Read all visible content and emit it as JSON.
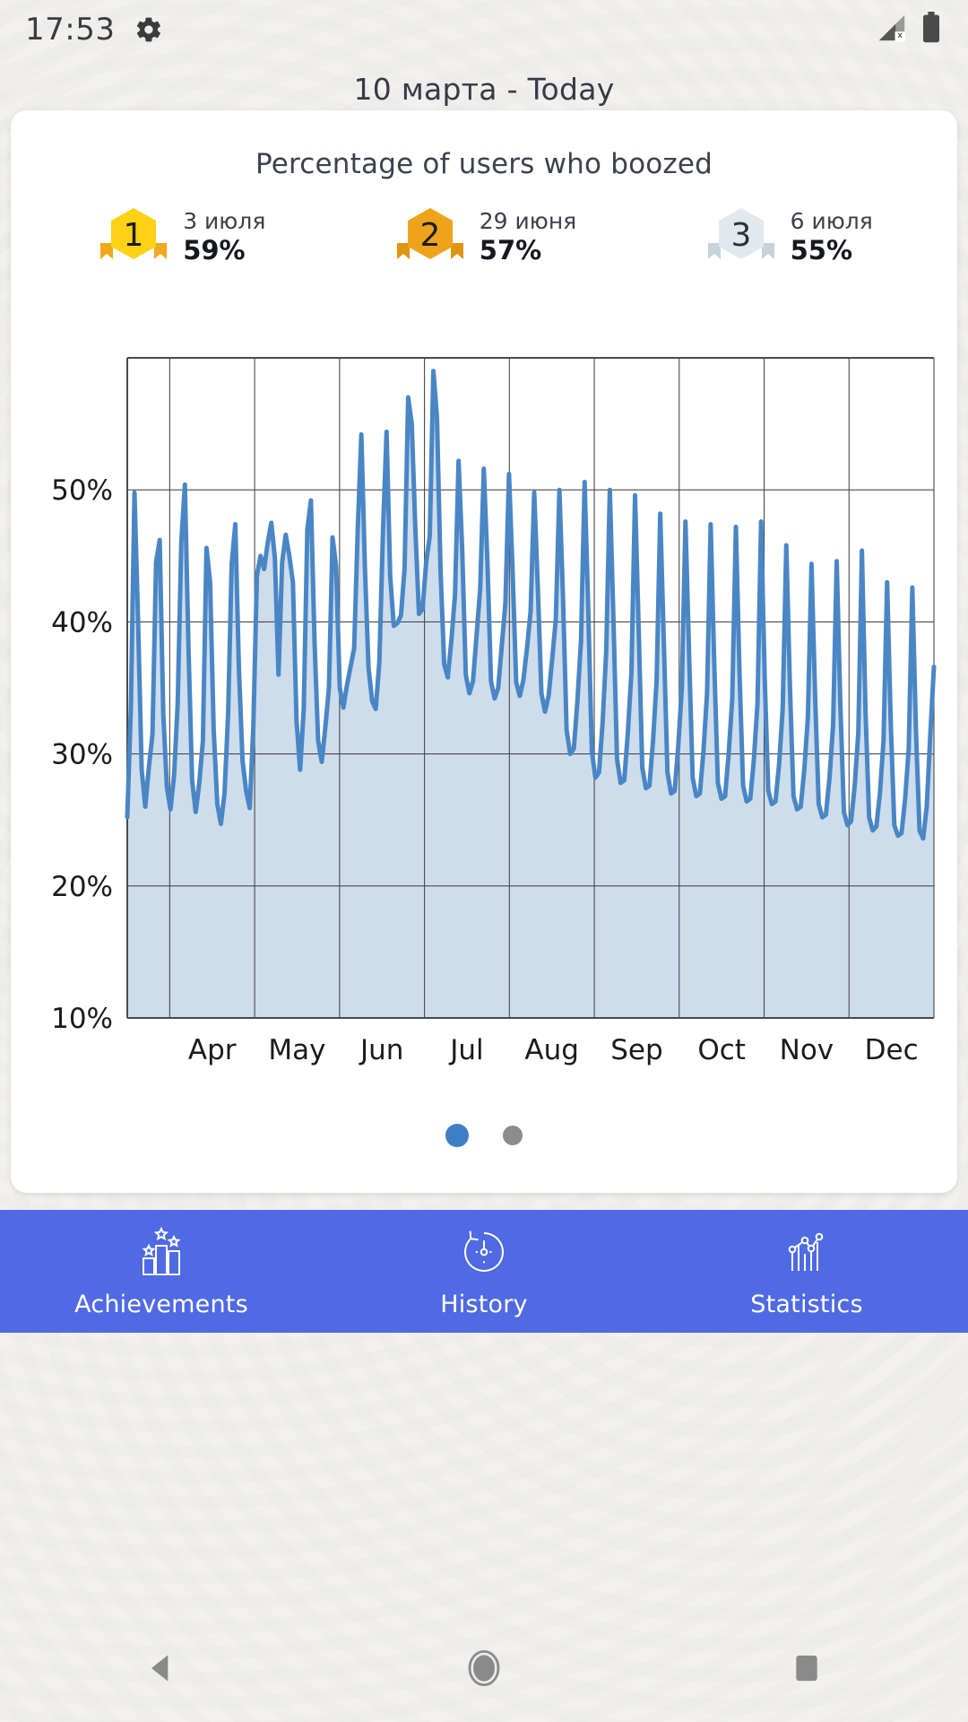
{
  "status_bar": {
    "time": "17:53",
    "gear_icon": "gear-icon",
    "signal_icon": "signal-no-sim-icon",
    "battery_icon": "battery-full-icon"
  },
  "header": {
    "title": "10 марта - Today"
  },
  "card": {
    "title": "Percentage of users who boozed",
    "podium": [
      {
        "rank": "1",
        "date": "3 июля",
        "percent": "59%",
        "color": "#fcd116",
        "ribbon": "#f0a91c",
        "num_color": "#1d1d1b"
      },
      {
        "rank": "2",
        "date": "29 июня",
        "percent": "57%",
        "color": "#eda41c",
        "ribbon": "#e0940f",
        "num_color": "#1d1d1b"
      },
      {
        "rank": "3",
        "date": "6 июля",
        "percent": "55%",
        "color": "#e2e8ed",
        "ribbon": "#c7d2da",
        "num_color": "#2b3138"
      }
    ]
  },
  "pager": {
    "dots": [
      {
        "label": "page-1",
        "active": true
      },
      {
        "label": "page-2",
        "active": false
      }
    ],
    "active_color": "#3c7fc4",
    "inactive_color": "#8c8c8c"
  },
  "bottom_nav": {
    "background": "#506ae4",
    "items": [
      {
        "label": "Achievements",
        "icon": "achievements-bars-stars-icon"
      },
      {
        "label": "History",
        "icon": "history-clock-rewind-icon"
      },
      {
        "label": "Statistics",
        "icon": "statistics-line-bar-icon"
      }
    ]
  },
  "android_nav": {
    "back": "back-triangle-icon",
    "home": "home-circle-icon",
    "recents": "recents-square-icon"
  },
  "chart_data": {
    "type": "area",
    "title": "Percentage of users who boozed",
    "xlabel": "",
    "ylabel": "",
    "grid": true,
    "legend": "none",
    "line_color": "#4a86c5",
    "fill_color": "#cdddec",
    "ylim": [
      10,
      60
    ],
    "yticks": [
      10,
      20,
      30,
      40,
      50
    ],
    "ytick_labels": [
      "10%",
      "20%",
      "30%",
      "40%",
      "50%"
    ],
    "xticks": [
      "Apr",
      "May",
      "Jun",
      "Jul",
      "Aug",
      "Sep",
      "Oct",
      "Nov",
      "Dec"
    ],
    "xlim_note": "mid-March through early December, daily samples with strong weekly cycle",
    "series": [
      {
        "name": "Percentage of users who boozed",
        "values": [
          25.2,
          33.5,
          49.8,
          40.0,
          28.8,
          26.0,
          29.0,
          31.5,
          44.5,
          46.2,
          33.0,
          27.5,
          25.8,
          28.4,
          33.8,
          46.0,
          50.4,
          38.0,
          28.0,
          25.6,
          27.8,
          31.0,
          45.6,
          43.0,
          31.8,
          26.2,
          24.7,
          27.0,
          33.0,
          44.4,
          47.4,
          36.5,
          29.5,
          27.2,
          25.9,
          32.0,
          43.5,
          45.0,
          44.0,
          46.0,
          47.5,
          44.8,
          36.0,
          44.5,
          46.6,
          45.0,
          43.0,
          32.5,
          28.8,
          33.4,
          47.0,
          49.2,
          38.5,
          31.0,
          29.4,
          32.0,
          35.0,
          46.4,
          44.2,
          35.0,
          33.5,
          35.2,
          36.6,
          38.0,
          47.0,
          54.2,
          44.0,
          36.5,
          34.0,
          33.4,
          37.0,
          46.8,
          54.4,
          43.5,
          39.7,
          39.9,
          40.5,
          44.0,
          57.0,
          55.0,
          47.0,
          40.6,
          41.0,
          44.5,
          46.5,
          59.0,
          55.5,
          43.8,
          36.8,
          35.8,
          38.6,
          42.0,
          52.2,
          45.5,
          36.0,
          34.6,
          35.5,
          39.0,
          42.5,
          51.6,
          44.6,
          35.5,
          34.2,
          35.0,
          38.2,
          41.4,
          51.2,
          43.8,
          35.4,
          34.4,
          35.6,
          38.0,
          40.8,
          49.8,
          42.6,
          34.6,
          33.2,
          34.4,
          37.2,
          40.2,
          50.0,
          41.8,
          31.8,
          30.0,
          30.4,
          34.0,
          38.6,
          50.6,
          41.0,
          30.2,
          28.2,
          28.6,
          32.4,
          37.8,
          50.0,
          40.2,
          29.6,
          27.8,
          28.0,
          31.6,
          36.2,
          49.6,
          39.5,
          29.0,
          27.4,
          27.6,
          31.0,
          35.6,
          48.2,
          38.4,
          28.6,
          27.0,
          27.2,
          30.6,
          35.0,
          47.6,
          37.6,
          28.2,
          26.8,
          27.0,
          30.2,
          34.6,
          47.4,
          36.8,
          27.8,
          26.6,
          26.8,
          30.0,
          34.2,
          47.2,
          36.2,
          27.6,
          26.4,
          26.6,
          29.6,
          33.8,
          47.6,
          35.8,
          27.2,
          26.2,
          26.4,
          29.2,
          33.4,
          45.8,
          35.2,
          26.8,
          25.8,
          26.0,
          28.8,
          32.8,
          44.4,
          34.4,
          26.2,
          25.2,
          25.4,
          28.2,
          32.2,
          44.6,
          33.8,
          25.6,
          24.6,
          24.9,
          27.6,
          31.6,
          45.4,
          33.2,
          25.2,
          24.2,
          24.5,
          27.0,
          31.0,
          43.0,
          32.4,
          24.6,
          23.8,
          24.0,
          26.6,
          30.4,
          42.6,
          31.8,
          24.2,
          23.6,
          26.0,
          31.5,
          36.6
        ]
      }
    ]
  }
}
